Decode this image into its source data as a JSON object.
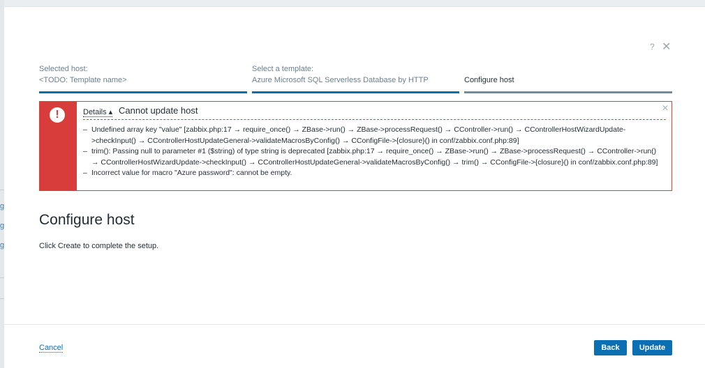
{
  "background": {
    "marks": [
      "g",
      "g",
      "g"
    ]
  },
  "header": {
    "help_icon": "?",
    "close_icon": "✕"
  },
  "steps": [
    {
      "label": "Selected host:",
      "value": "<TODO: Template name>"
    },
    {
      "label": "Select a template:",
      "value": "Azure Microsoft SQL Serverless Database by HTTP"
    },
    {
      "label": "",
      "value": "Configure host"
    }
  ],
  "error": {
    "icon": "!",
    "details_label": "Details ▴",
    "title": "Cannot update host",
    "close_icon": "✕",
    "dash": "–",
    "messages": [
      "Undefined array key \"value\" [zabbix.php:17 → require_once() → ZBase->run() → ZBase->processRequest() → CController->run() → CControllerHostWizardUpdate->checkInput() → CControllerHostUpdateGeneral->validateMacrosByConfig() → CConfigFile->{closure}() in conf/zabbix.conf.php:89]",
      "trim(): Passing null to parameter #1 ($string) of type string is deprecated [zabbix.php:17 → require_once() → ZBase->run() → ZBase->processRequest() → CController->run() → CControllerHostWizardUpdate->checkInput() → CControllerHostUpdateGeneral->validateMacrosByConfig() → trim() → CConfigFile->{closure}() in conf/zabbix.conf.php:89]",
      "Incorrect value for macro \"Azure password\": cannot be empty."
    ]
  },
  "main": {
    "title": "Configure host",
    "description": "Click Create to complete the setup."
  },
  "footer": {
    "cancel_label": "Cancel",
    "back_label": "Back",
    "update_label": "Update"
  },
  "colors": {
    "accent": "#0a6fb3",
    "error": "#d93d3b"
  }
}
